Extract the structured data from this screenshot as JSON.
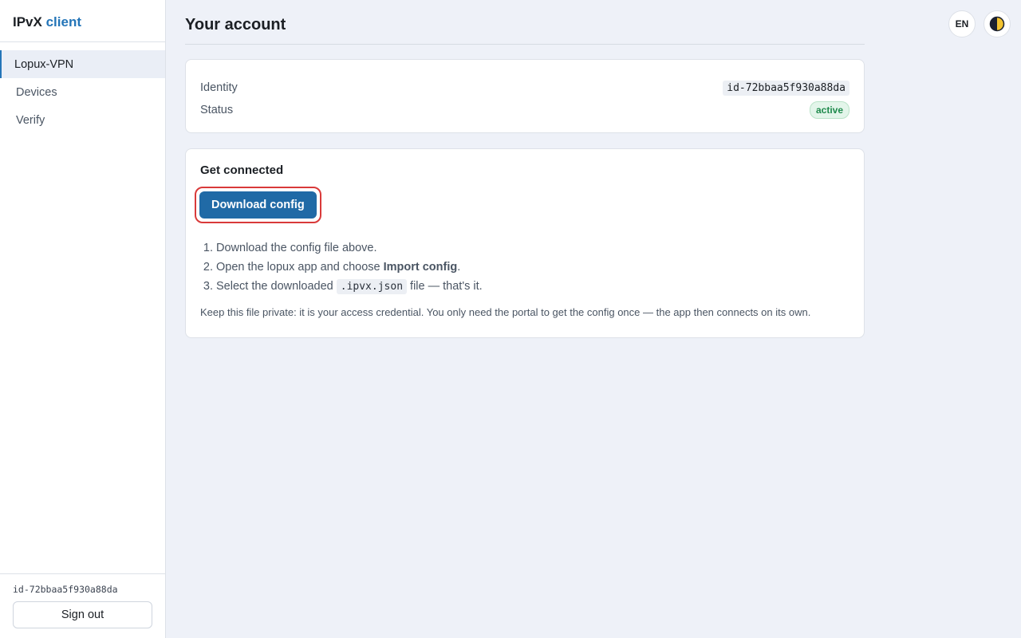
{
  "brand": {
    "name": "IPvX",
    "accent": "client"
  },
  "sidebar": {
    "items": [
      {
        "label": "Lopux-VPN",
        "active": true
      },
      {
        "label": "Devices",
        "active": false
      },
      {
        "label": "Verify",
        "active": false
      }
    ],
    "user_id": "id-72bbaa5f930a88da",
    "sign_out_label": "Sign out"
  },
  "header": {
    "title": "Your account",
    "language": "EN",
    "theme_icon": "half-moon-icon"
  },
  "account": {
    "identity_label": "Identity",
    "identity_value": "id-72bbaa5f930a88da",
    "status_label": "Status",
    "status_value": "active"
  },
  "connect": {
    "title": "Get connected",
    "download_label": "Download config",
    "step1": "Download the config file above.",
    "step2_pre": "Open the lopux app and choose ",
    "step2_bold": "Import config",
    "step2_post": ".",
    "step3_pre": "Select the downloaded ",
    "step3_code": ".ipvx.json",
    "step3_post": " file — that's it.",
    "note": "Keep this file private: it is your access credential. You only need the portal to get the config once — the app then connects on its own."
  },
  "colors": {
    "accent": "#2475b8",
    "button": "#206aa6",
    "status_active": "#1f8a4c",
    "highlight_ring": "#d93a3a",
    "background": "#eef1f8"
  }
}
